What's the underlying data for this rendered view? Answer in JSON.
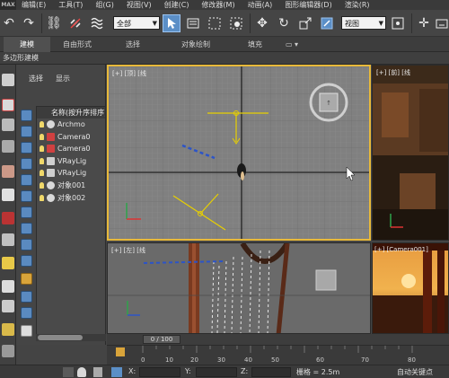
{
  "menubar": {
    "logo": "MAX",
    "items": [
      "编辑(E)",
      "工具(T)",
      "组(G)",
      "视图(V)",
      "创建(C)",
      "修改器(M)",
      "动画(A)",
      "图形编辑器(D)",
      "渲染(R)"
    ]
  },
  "toolbar": {
    "selection_filter": "全部",
    "ref_coord": "视图"
  },
  "ribbon": {
    "tabs": [
      "建模",
      "自由形式",
      "选择",
      "对象绘制",
      "填充"
    ],
    "sub_label": "多边形建模"
  },
  "explorer": {
    "tab_select": "选择",
    "tab_display": "显示",
    "column_header": "名称(按升序排序)",
    "objects": [
      {
        "name": "Archmo",
        "kind": "geometry"
      },
      {
        "name": "Camera0",
        "kind": "camera"
      },
      {
        "name": "Camera0",
        "kind": "camera"
      },
      {
        "name": "VRayLig",
        "kind": "light"
      },
      {
        "name": "VRayLig",
        "kind": "light"
      },
      {
        "name": "对象001",
        "kind": "geometry"
      },
      {
        "name": "对象002",
        "kind": "geometry"
      }
    ]
  },
  "viewports": {
    "top": "[+] [顶] [线",
    "front": "[+] [前] [线",
    "left": "[+] [左] [线",
    "camera": "[+] [Camera001]"
  },
  "timeline": {
    "frame_display": "0 / 100",
    "ticks": [
      "0",
      "10",
      "20",
      "30",
      "40",
      "50",
      "60",
      "70",
      "80"
    ]
  },
  "status": {
    "x_label": "X:",
    "y_label": "Y:",
    "z_label": "Z:",
    "grid": "栅格 = 2.5m",
    "autokey": "自动关键点"
  },
  "colors": {
    "active_viewport_border": "#e8b93a",
    "selected_tool": "#5b8fc7"
  }
}
